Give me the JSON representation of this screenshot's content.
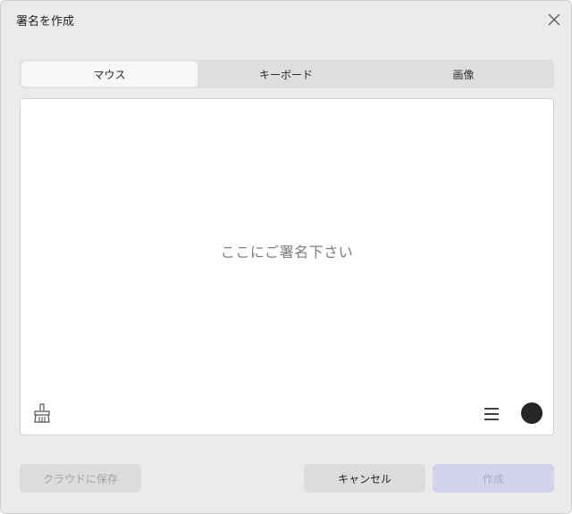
{
  "dialog": {
    "title": "署名を作成"
  },
  "tabs": [
    {
      "label": "マウス",
      "active": true
    },
    {
      "label": "キーボード",
      "active": false
    },
    {
      "label": "画像",
      "active": false
    }
  ],
  "canvas": {
    "placeholder": "ここにご署名下さい",
    "pen_color": "#262626"
  },
  "footer": {
    "cloud_save_label": "クラウドに保存",
    "cancel_label": "キャンセル",
    "create_label": "作成"
  },
  "icons": {
    "close": "close-icon",
    "clear": "broom-icon",
    "menu": "menu-icon",
    "color": "color-dot"
  }
}
